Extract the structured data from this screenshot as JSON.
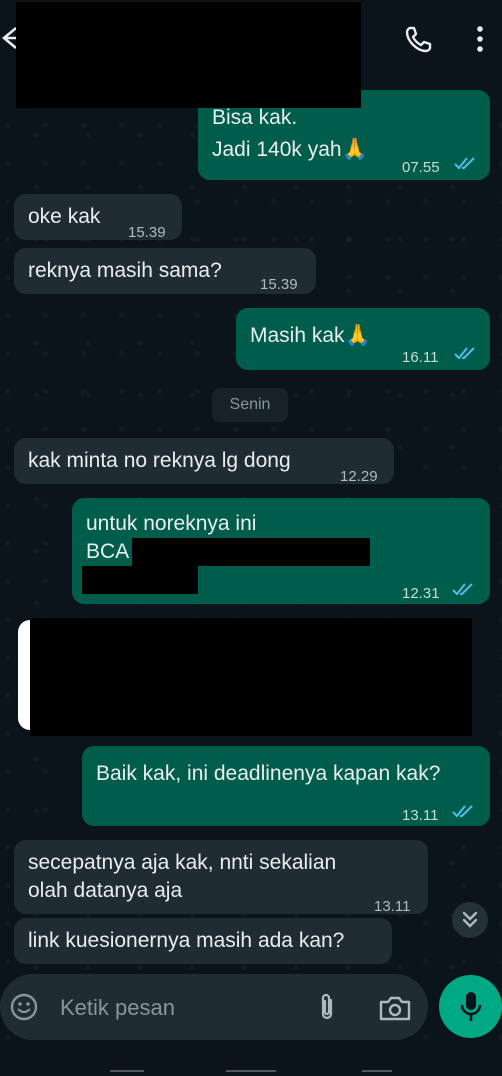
{
  "header": {
    "back_icon": "arrow-left-icon",
    "call_icon": "phone-icon",
    "menu_icon": "more-vertical-icon"
  },
  "messages": [
    {
      "direction": "out",
      "lines": [
        "Bisa kak.",
        "Jadi 140k yah🙏"
      ],
      "time": "07.55",
      "status": "read"
    },
    {
      "direction": "in",
      "lines": [
        "oke kak"
      ],
      "time": "15.39"
    },
    {
      "direction": "in",
      "lines": [
        "reknya masih sama?"
      ],
      "time": "15.39"
    },
    {
      "direction": "out",
      "lines": [
        "Masih kak🙏"
      ],
      "time": "16.11",
      "status": "read"
    },
    {
      "direction": "in",
      "lines": [
        "kak minta no reknya lg dong"
      ],
      "time": "12.29"
    },
    {
      "direction": "out",
      "lines": [
        "untuk noreknya ini",
        "BCA"
      ],
      "time": "12.31",
      "status": "read"
    },
    {
      "direction": "out",
      "lines": [
        "Baik kak, ini deadlinenya kapan kak?"
      ],
      "time": "13.11",
      "status": "read"
    },
    {
      "direction": "in",
      "lines": [
        "secepatnya aja kak, nnti sekalian",
        "olah datanya aja"
      ],
      "time": "13.11"
    },
    {
      "direction": "in",
      "lines": [
        "link kuesionernya masih ada kan?"
      ],
      "time": ""
    }
  ],
  "day_separator": "Senin",
  "composer": {
    "placeholder": "Ketik pesan",
    "emoji_icon": "emoji-icon",
    "attach_icon": "paperclip-icon",
    "camera_icon": "camera-icon",
    "mic_icon": "microphone-icon"
  },
  "scroll_down_icon": "double-chevron-down-icon",
  "colors": {
    "background": "#0b141a",
    "outgoing_bubble": "#005c4b",
    "incoming_bubble": "#202c33",
    "accent": "#00a884",
    "read_ticks": "#53bdeb"
  }
}
